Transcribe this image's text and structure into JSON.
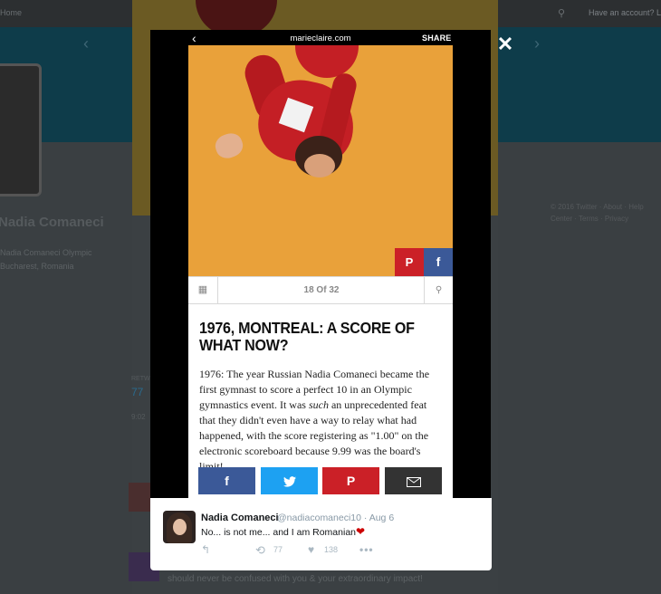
{
  "background": {
    "left_nav_text": "Home",
    "account_prompt": "Have an account? Log in",
    "profile_name": "Nadia Comaneci",
    "bio_lines": [
      "Nadia Comaneci Olympic",
      "Bucharest, Romania"
    ],
    "right_footer_lines": [
      "© 2016 Twitter · About · Help",
      "Center · Terms · Privacy"
    ],
    "stat_label": "RETWEETS",
    "stat_value": "77",
    "time_text": "9:02",
    "bottom_tweet_text": "should never be confused with you & your extraordinary impact!"
  },
  "lightbox": {
    "close_label": "✕",
    "embed": {
      "domain": "marieclaire.com",
      "share_label": "SHARE",
      "counter": "18 Of 32",
      "headline": "1976, MONTREAL: A SCORE OF WHAT NOW?",
      "body_before": "1976: The year Russian Nadia Comaneci became the first gymnast to score a perfect 10 in an Olympic gymnastics event. It was ",
      "body_em": "such",
      "body_after": " an unprecedented feat that they didn't even have a way to relay what had happened, with the score registering as \"1.00\" on the electronic scoreboard because 9.99 was the board's limit!"
    },
    "share_icons": {
      "facebook": "f",
      "twitter": "twitter-bird-icon",
      "pinterest": "P",
      "email": "envelope-icon"
    }
  },
  "tweet": {
    "name": "Nadia Comaneci",
    "handle": "@nadiacomaneci10 · Aug 6",
    "text": "No... is not me... and I am Romanian",
    "retweet_count": "77",
    "like_count": "138"
  },
  "colors": {
    "facebook": "#3b5998",
    "twitter": "#1da1f2",
    "pinterest": "#cb2027",
    "email": "#333333",
    "hero_bg": "#e9a13a"
  }
}
